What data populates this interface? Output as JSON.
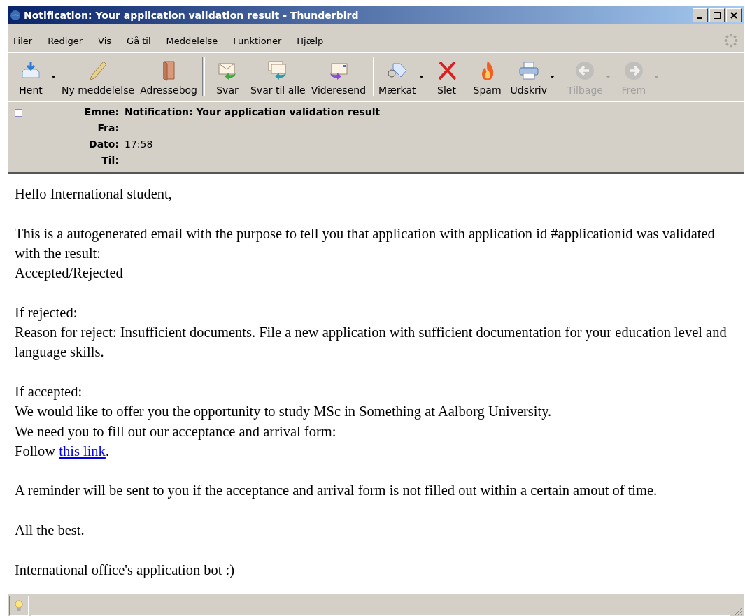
{
  "window": {
    "title": "Notification: Your application validation result - Thunderbird"
  },
  "menu": [
    "Filer",
    "Rediger",
    "Vis",
    "Gå til",
    "Meddelelse",
    "Funktioner",
    "Hjælp"
  ],
  "toolbar": [
    [
      {
        "label": "Hent",
        "dropdown": true,
        "disabled": false
      },
      {
        "label": "Ny meddelelse",
        "dropdown": false,
        "disabled": false
      },
      {
        "label": "Adressebog",
        "dropdown": false,
        "disabled": false
      }
    ],
    [
      {
        "label": "Svar",
        "dropdown": false,
        "disabled": false
      },
      {
        "label": "Svar til alle",
        "dropdown": false,
        "disabled": false
      },
      {
        "label": "Videresend",
        "dropdown": false,
        "disabled": false
      }
    ],
    [
      {
        "label": "Mærkat",
        "dropdown": true,
        "disabled": false
      },
      {
        "label": "Slet",
        "dropdown": false,
        "disabled": false
      },
      {
        "label": "Spam",
        "dropdown": false,
        "disabled": false
      },
      {
        "label": "Udskriv",
        "dropdown": true,
        "disabled": false
      }
    ],
    [
      {
        "label": "Tilbage",
        "dropdown": true,
        "disabled": true
      },
      {
        "label": "Frem",
        "dropdown": true,
        "disabled": true
      }
    ]
  ],
  "header": {
    "expanded": true,
    "fields": [
      {
        "label": "Emne:",
        "value": "Notification: Your application validation result",
        "bold": true
      },
      {
        "label": "Fra:"
      },
      {
        "label": "Dato:",
        "value": "17:58",
        "bold": false
      },
      {
        "label": "Til:"
      }
    ]
  },
  "body": [
    [
      [
        {
          "kind": "text",
          "text": "Hello International student,"
        }
      ]
    ],
    [
      [
        {
          "kind": "text",
          "text": "This is a autogenerated email with the purpose to tell you that application with application id #applicationid was validated with the result:"
        }
      ],
      [
        {
          "kind": "text",
          "text": "Accepted/Rejected"
        }
      ]
    ],
    [
      [
        {
          "kind": "text",
          "text": "If rejected:"
        }
      ],
      [
        {
          "kind": "text",
          "text": "Reason for reject: Insufficient documents. File a new application with sufficient documentation for your education level and language skills."
        }
      ]
    ],
    [
      [
        {
          "kind": "text",
          "text": "If accepted:"
        }
      ],
      [
        {
          "kind": "text",
          "text": "We would like to offer you the opportunity to study MSc in Something at Aalborg University."
        }
      ],
      [
        {
          "kind": "text",
          "text": "We need you to fill out our acceptance and arrival form:"
        }
      ],
      [
        {
          "kind": "text",
          "text": "Follow "
        },
        {
          "kind": "link",
          "text": "this link"
        },
        {
          "kind": "text",
          "text": "."
        }
      ]
    ],
    [
      [
        {
          "kind": "text",
          "text": "A reminder will be sent to you if the acceptance and arrival form is not filled out within a certain amout of time."
        }
      ]
    ],
    [
      [
        {
          "kind": "text",
          "text": "All the best."
        }
      ]
    ],
    [
      [
        {
          "kind": "text",
          "text": "International office's application bot :)"
        }
      ]
    ]
  ]
}
